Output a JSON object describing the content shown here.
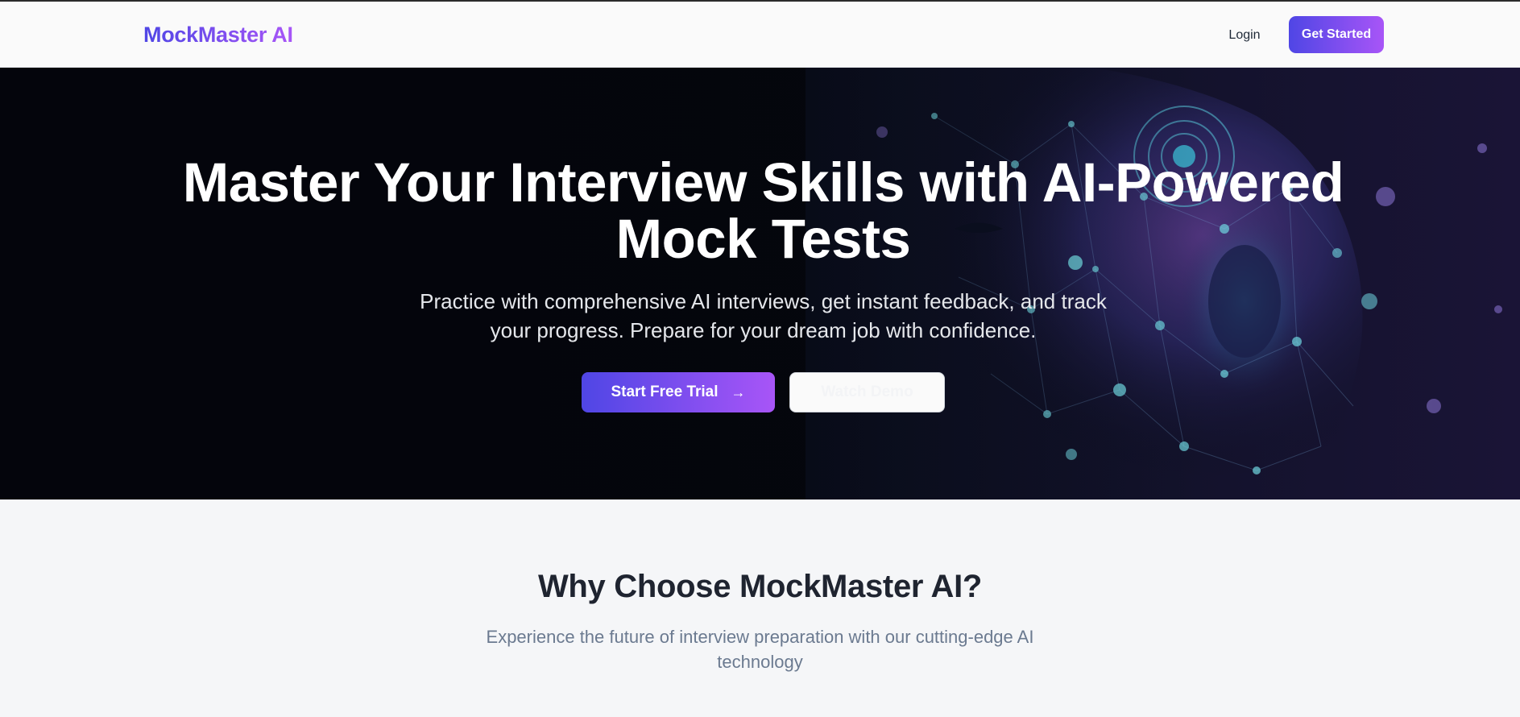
{
  "navbar": {
    "logo": "MockMaster AI",
    "login_label": "Login",
    "cta_label": "Get Started"
  },
  "hero": {
    "title": "Master Your Interview Skills with AI-Powered Mock Tests",
    "subtitle": "Practice with comprehensive AI interviews, get instant feedback, and track your progress. Prepare for your dream job with confidence.",
    "primary_button": "Start Free Trial",
    "primary_button_icon": "arrow-right-icon",
    "secondary_button": "Watch Demo",
    "background_image": "ai-head-network-illustration"
  },
  "features": {
    "title": "Why Choose MockMaster AI?",
    "subtitle": "Experience the future of interview preparation with our cutting-edge AI technology"
  },
  "colors": {
    "brand_gradient_start": "#4f46e5",
    "brand_gradient_end": "#a855f7",
    "hero_bg": "#06070f",
    "page_bg": "#f5f6f8",
    "heading": "#1f2430",
    "muted": "#6b7a90"
  }
}
